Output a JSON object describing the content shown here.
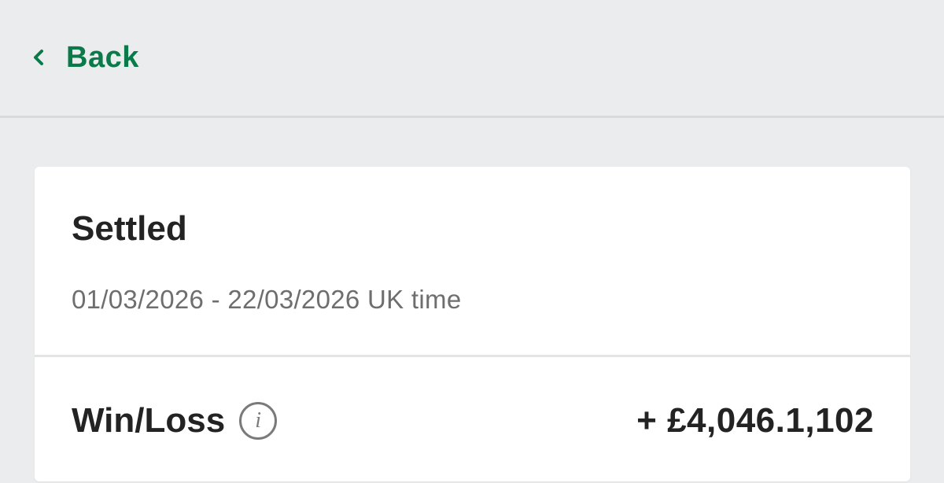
{
  "header": {
    "back_label": "Back",
    "back_icon": "chevron-left-icon",
    "accent_color": "#0a7a4b"
  },
  "card": {
    "title": "Settled",
    "date_range": "01/03/2026 - 22/03/2026 UK time",
    "win_loss": {
      "label": "Win/Loss",
      "info_icon": "info-icon",
      "info_glyph": "i",
      "value": "+ £4,046.1,102"
    }
  }
}
